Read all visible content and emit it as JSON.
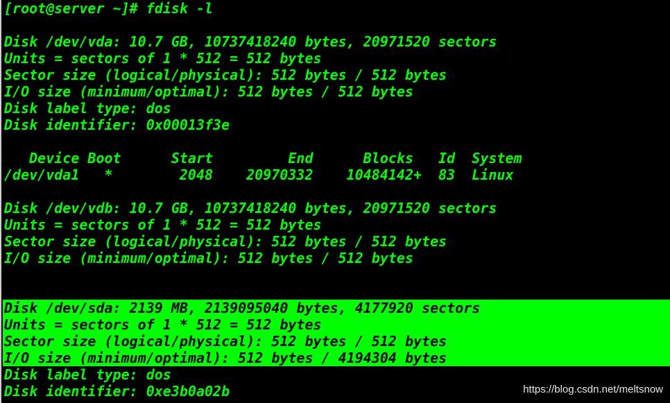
{
  "terminal": {
    "lines": [
      "[root@server ~]# fdisk -l",
      "",
      "Disk /dev/vda: 10.7 GB, 10737418240 bytes, 20971520 sectors",
      "Units = sectors of 1 * 512 = 512 bytes",
      "Sector size (logical/physical): 512 bytes / 512 bytes",
      "I/O size (minimum/optimal): 512 bytes / 512 bytes",
      "Disk label type: dos",
      "Disk identifier: 0x00013f3e",
      "",
      "   Device Boot      Start         End      Blocks   Id  System",
      "/dev/vda1   *        2048    20970332    10484142+  83  Linux",
      "",
      "Disk /dev/vdb: 10.7 GB, 10737418240 bytes, 20971520 sectors",
      "Units = sectors of 1 * 512 = 512 bytes",
      "Sector size (logical/physical): 512 bytes / 512 bytes",
      "I/O size (minimum/optimal): 512 bytes / 512 bytes",
      "",
      "",
      "Disk /dev/sda: 2139 MB, 2139095040 bytes, 4177920 sectors",
      "Units = sectors of 1 * 512 = 512 bytes",
      "Sector size (logical/physical): 512 bytes / 512 bytes",
      "I/O size (minimum/optimal): 512 bytes / 4194304 bytes",
      "Disk label type: dos",
      "Disk identifier: 0xe3b0a02b"
    ]
  },
  "watermark": "https://blog.csdn.net/meltsnow",
  "colors": {
    "background": "#000000",
    "text": "#00ff00",
    "highlight_background": "#00ff00",
    "highlight_text": "#000000"
  }
}
